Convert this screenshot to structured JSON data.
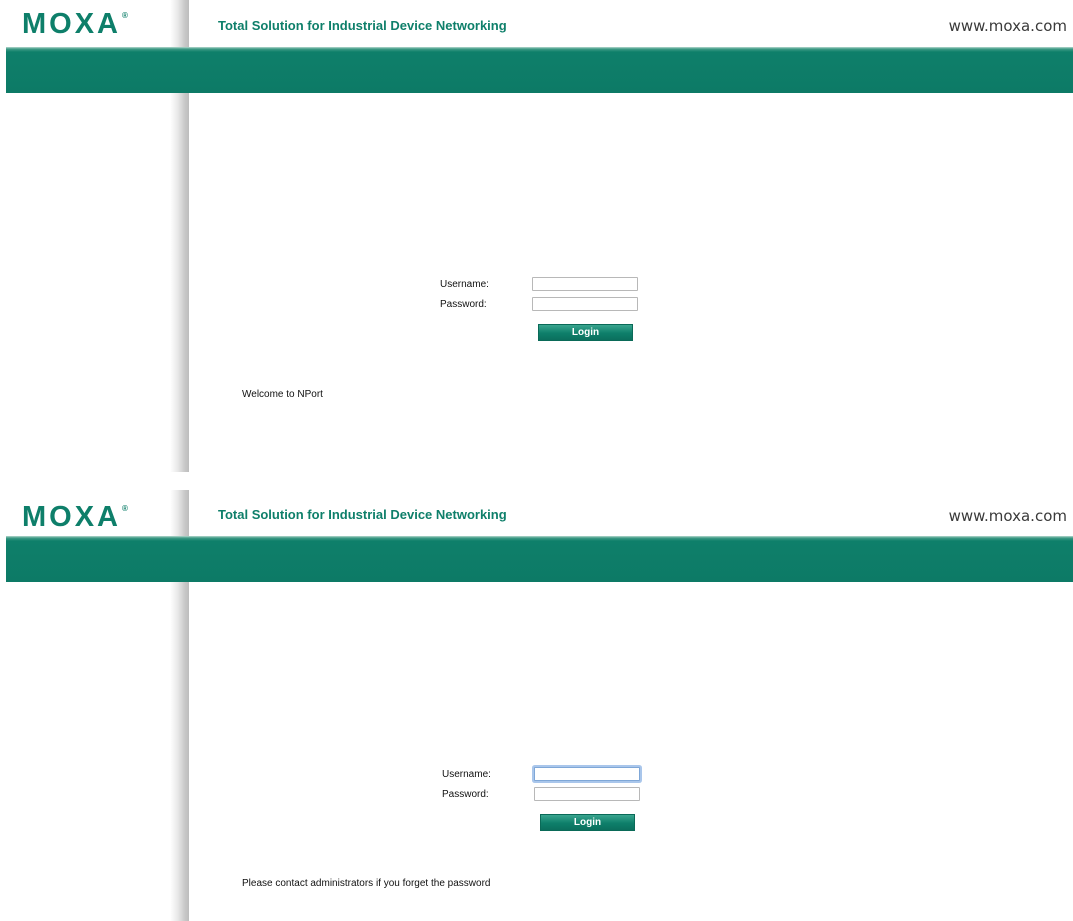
{
  "screens": [
    {
      "brand": {
        "logo_text": "MOXA",
        "registered_mark": "®"
      },
      "tagline": "Total Solution for Industrial Device Networking",
      "site_url": "www.moxa.com",
      "login": {
        "username_label": "Username:",
        "password_label": "Password:",
        "username_value": "",
        "password_value": "",
        "username_focused": false,
        "submit_label": "Login"
      },
      "message": "Welcome to NPort"
    },
    {
      "brand": {
        "logo_text": "MOXA",
        "registered_mark": "®"
      },
      "tagline": "Total Solution for Industrial Device Networking",
      "site_url": "www.moxa.com",
      "login": {
        "username_label": "Username:",
        "password_label": "Password:",
        "username_value": "",
        "password_value": "",
        "username_focused": true,
        "submit_label": "Login"
      },
      "message": "Please contact administrators if you forget the password"
    }
  ],
  "colors": {
    "brand_green": "#0e7f6a",
    "focus_ring": "#a9c6eb"
  }
}
